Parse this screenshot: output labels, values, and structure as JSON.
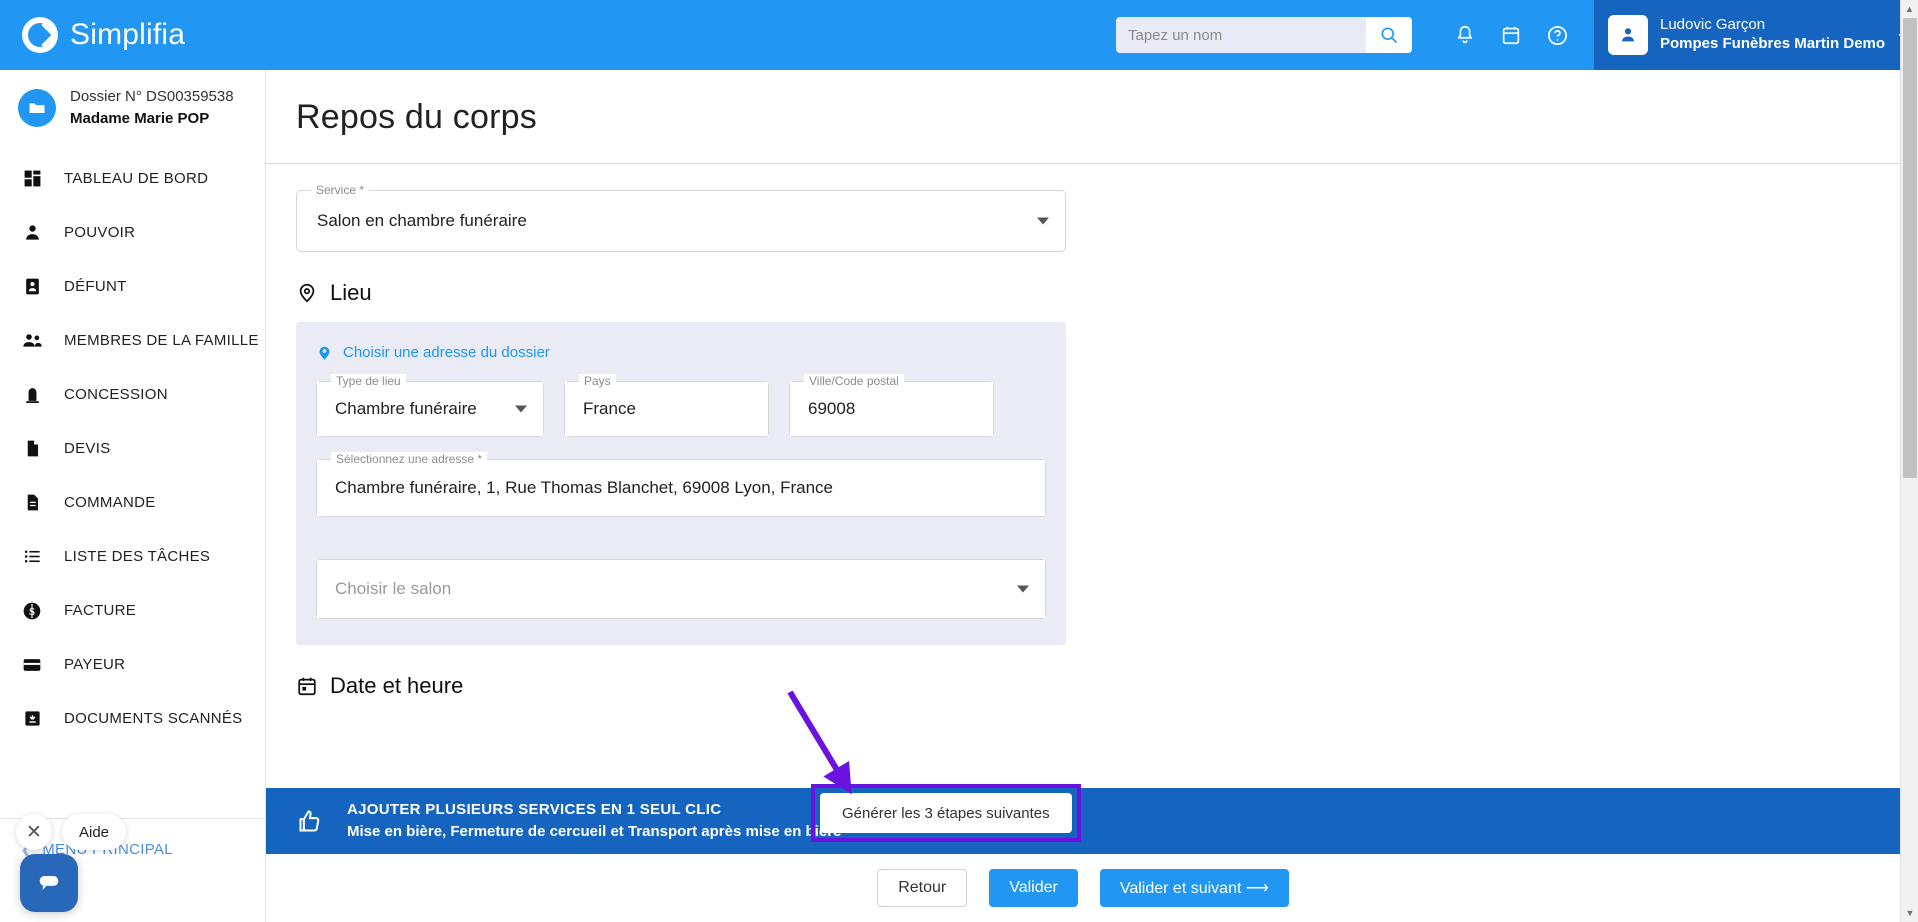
{
  "header": {
    "brand": "Simplifia",
    "search": {
      "placeholder": "Tapez un nom",
      "value": ""
    },
    "icons": {
      "search": "search-icon",
      "bell": "bell-icon",
      "calendar": "calendar-icon",
      "help": "help-circle-icon"
    },
    "user": {
      "name": "Ludovic Garçon",
      "org": "Pompes Funèbres Martin Demo"
    }
  },
  "sidebar": {
    "dossier": {
      "number": "Dossier N° DS00359538",
      "person": "Madame Marie POP"
    },
    "items": [
      {
        "label": "TABLEAU DE BORD",
        "icon": "dashboard-icon"
      },
      {
        "label": "POUVOIR",
        "icon": "person-icon"
      },
      {
        "label": "DÉFUNT",
        "icon": "id-card-icon"
      },
      {
        "label": "MEMBRES DE LA FAMILLE",
        "icon": "people-icon"
      },
      {
        "label": "CONCESSION",
        "icon": "headstone-icon"
      },
      {
        "label": "DEVIS",
        "icon": "document-icon"
      },
      {
        "label": "COMMANDE",
        "icon": "document-lines-icon"
      },
      {
        "label": "LISTE DES TÂCHES",
        "icon": "list-icon"
      },
      {
        "label": "FACTURE",
        "icon": "dollar-coin-icon"
      },
      {
        "label": "PAYEUR",
        "icon": "credit-card-icon"
      },
      {
        "label": "DOCUMENTS SCANNÉS",
        "icon": "scanned-docs-icon"
      }
    ],
    "menu_principal": "MENU PRINCIPAL"
  },
  "help_widget": {
    "close": "✕",
    "label": "Aide",
    "chat_icon": "chat-bubble-icon"
  },
  "main": {
    "page_title": "Repos du corps",
    "service": {
      "label": "Service *",
      "value": "Salon en chambre funéraire"
    },
    "lieu": {
      "section_title": "Lieu",
      "section_icon": "location-pin-icon",
      "choose_address_link": "Choisir une adresse du dossier",
      "fields": [
        {
          "label": "Type de lieu",
          "value": "Chambre funéraire",
          "type": "select"
        },
        {
          "label": "Pays",
          "value": "France",
          "type": "text"
        },
        {
          "label": "Ville/Code postal",
          "value": "69008",
          "type": "text"
        }
      ],
      "address": {
        "label": "Sélectionnez une adresse *",
        "value": "Chambre funéraire,  1, Rue Thomas Blanchet, 69008 Lyon, France"
      },
      "salon": {
        "placeholder": "Choisir le salon",
        "value": ""
      }
    },
    "date_section": {
      "title": "Date et heure",
      "icon": "calendar-icon"
    }
  },
  "promo": {
    "icon": "thumbs-up-icon",
    "line1": "AJOUTER PLUSIEURS SERVICES EN 1 SEUL CLIC",
    "line2": "Mise en bière, Fermeture de cercueil et Transport après mise en bière",
    "button": "Générer les 3 étapes suivantes"
  },
  "footer": {
    "back": "Retour",
    "validate": "Valider",
    "validate_next": "Valider et suivant ⟶"
  },
  "colors": {
    "brand_blue": "#2196f3",
    "dark_blue": "#1565c0",
    "panel_lavender": "#eaebf5",
    "annotation_purple": "#6a12e0"
  }
}
